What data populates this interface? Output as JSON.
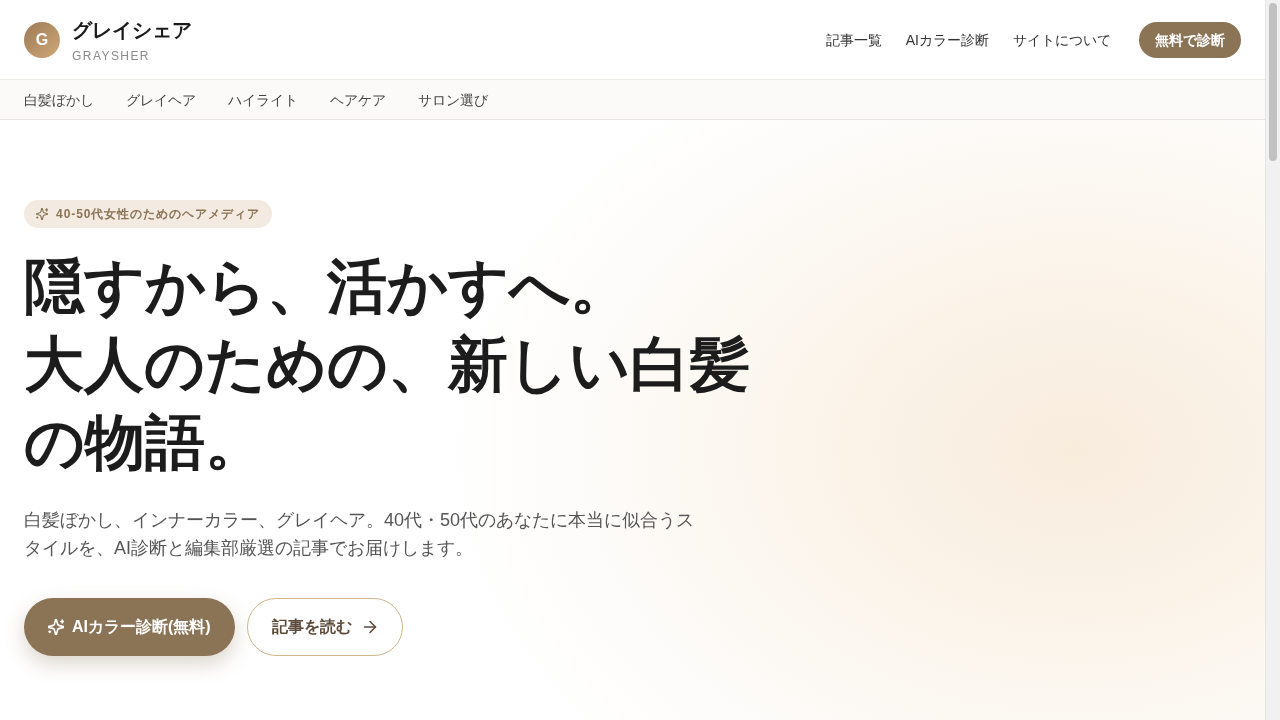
{
  "header": {
    "logo": {
      "letter": "G",
      "name": "グレイシェア",
      "subtitle": "GRAYSHER"
    },
    "nav": [
      "記事一覧",
      "AIカラー診断",
      "サイトについて"
    ],
    "cta": "無料で診断"
  },
  "categories": [
    "白髪ぼかし",
    "グレイヘア",
    "ハイライト",
    "ヘアケア",
    "サロン選び"
  ],
  "hero": {
    "badge": "40-50代女性のためのヘアメディア",
    "headline": [
      "隠すから、活かすへ。",
      "大人のための、新しい白髪の物語。"
    ],
    "lead": "白髪ぼかし、インナーカラー、グレイヘア。40代・50代のあなたに本当に似合うスタイルを、AI診断と編集部厳選の記事でお届けします。",
    "buttons": [
      {
        "label": "AIカラー診断(無料)",
        "kind": "primary"
      },
      {
        "label": "記事を読む",
        "kind": "secondary"
      }
    ]
  }
}
